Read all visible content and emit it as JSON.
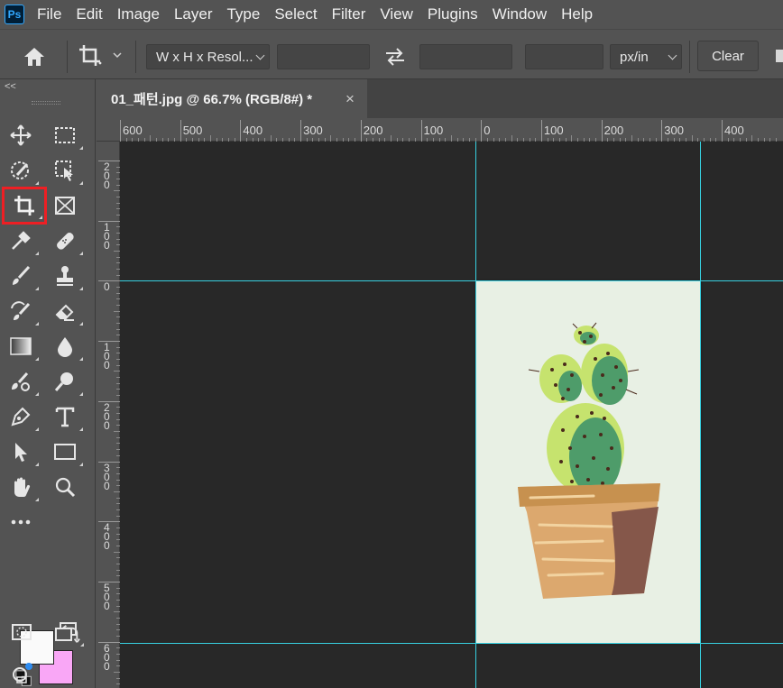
{
  "app": {
    "logo": "Ps"
  },
  "menu": [
    "File",
    "Edit",
    "Image",
    "Layer",
    "Type",
    "Select",
    "Filter",
    "View",
    "Plugins",
    "Window",
    "Help"
  ],
  "options": {
    "ratio_select": "W x H x Resol...",
    "width_value": "",
    "height_value": "",
    "resolution_value": "",
    "unit_select": "px/in",
    "clear_label": "Clear"
  },
  "toolbar": {
    "collapse_label": "<<",
    "selected_tool": "crop-tool",
    "foreground_color": "#fafafa",
    "background_color": "#f9a7f6"
  },
  "document": {
    "tab_title": "01_패턴.jpg @ 66.7% (RGB/8#) *",
    "close_label": "×"
  },
  "ruler": {
    "top_labels": [
      "600",
      "500",
      "400",
      "300",
      "200",
      "100",
      "0",
      "100",
      "200",
      "300",
      "400"
    ],
    "left_labels": [
      "2 0 0",
      "1 0 0",
      "0",
      "1 0 0",
      "2 0 0",
      "3 0 0",
      "4 0 0",
      "5 0 0",
      "6 0 0"
    ]
  },
  "colors": {
    "guide": "#37d0e0",
    "highlight": "#ee1f24",
    "pasteboard": "#282828",
    "doc_background": "#e8f0e4"
  }
}
